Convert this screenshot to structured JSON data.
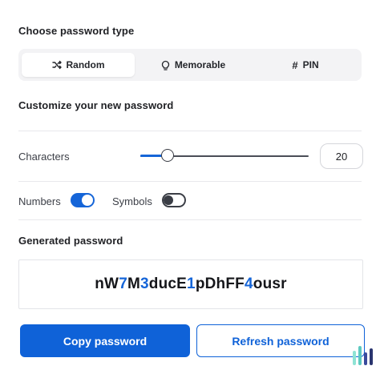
{
  "password_type": {
    "title": "Choose password type",
    "options": [
      {
        "label": "Random",
        "icon": "shuffle-icon",
        "active": true
      },
      {
        "label": "Memorable",
        "icon": "lightbulb-icon",
        "active": false
      },
      {
        "label": "PIN",
        "icon": "hash-icon",
        "active": false
      }
    ]
  },
  "customize": {
    "title": "Customize your new password",
    "characters_label": "Characters",
    "characters_value": "20",
    "slider_fraction": 0.16,
    "numbers_label": "Numbers",
    "numbers_on": true,
    "symbols_label": "Symbols",
    "symbols_on": false
  },
  "generated": {
    "title": "Generated password",
    "segments": [
      {
        "text": "nW",
        "digit": false
      },
      {
        "text": "7",
        "digit": true
      },
      {
        "text": "M",
        "digit": false
      },
      {
        "text": "3",
        "digit": true
      },
      {
        "text": "ducE",
        "digit": false
      },
      {
        "text": "1",
        "digit": true
      },
      {
        "text": "pDhFF",
        "digit": false
      },
      {
        "text": "4",
        "digit": true
      },
      {
        "text": "ousr",
        "digit": false
      }
    ]
  },
  "buttons": {
    "copy_label": "Copy password",
    "refresh_label": "Refresh password"
  },
  "colors": {
    "accent": "#0f62d8",
    "toggle_on": "#1565d8",
    "toggle_off": "#3a3d45"
  }
}
